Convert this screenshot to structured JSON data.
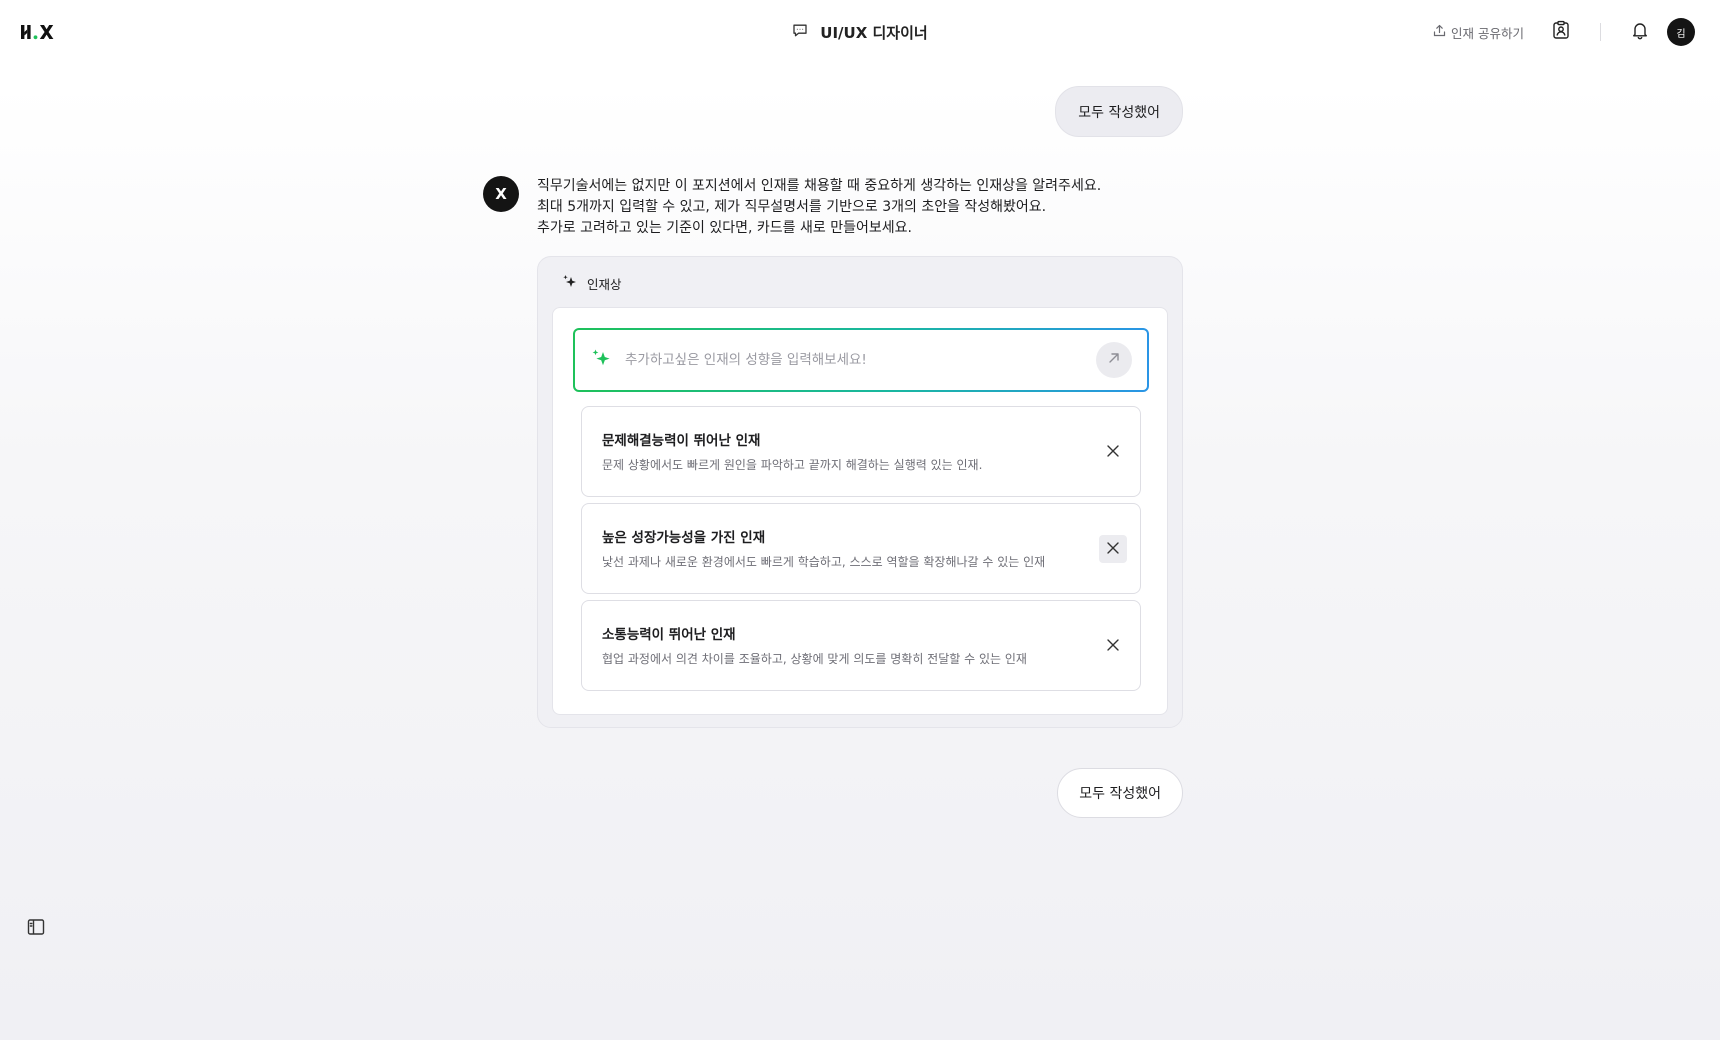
{
  "header": {
    "logo_text": "H.X",
    "title": "UI/UX 디자이너",
    "share_label": "인재 공유하기",
    "avatar_initial": "김"
  },
  "chat": {
    "user_message_1": "모두 작성했어",
    "bot_initial": "X",
    "bot_lines": [
      "직무기술서에는 없지만 이 포지션에서 인재를 채용할 때 중요하게 생각하는 인재상을 알려주세요.",
      "최대 5개까지 입력할 수 있고, 제가 직무설명서를 기반으로 3개의 초안을 작성해봤어요.",
      "추가로 고려하고 있는 기준이 있다면, 카드를 새로 만들어보세요."
    ]
  },
  "panel": {
    "title": "인재상",
    "input_placeholder": "추가하고싶은 인재의 성향을 입력해보세요!",
    "input_value": "",
    "cards": [
      {
        "title": "문제해결능력이 뛰어난 인재",
        "desc": "문제 상황에서도 빠르게 원인을 파악하고 끝까지 해결하는 실행력 있는 인재."
      },
      {
        "title": "높은 성장가능성을 가진 인재",
        "desc": "낯선 과제나 새로운 환경에서도 빠르게 학습하고, 스스로 역할을 확장해나갈 수 있는 인재"
      },
      {
        "title": "소통능력이 뛰어난 인재",
        "desc": "협업 과정에서 의견 차이를 조율하고, 상황에 맞게 의도를 명확히 전달할 수 있는 인재"
      }
    ]
  },
  "done_button_label": "모두 작성했어",
  "colors": {
    "accent_green": "#1ec15a",
    "accent_blue": "#2a95e6",
    "dark": "#141414"
  },
  "icons": {
    "chat": "chat-bubble-icon",
    "share": "upload-icon",
    "profile": "id-badge-icon",
    "notification": "bell-icon",
    "sparkle": "sparkle-icon",
    "send": "arrow-up-right-icon",
    "remove": "close-icon",
    "sidebar": "sidebar-toggle-icon"
  }
}
